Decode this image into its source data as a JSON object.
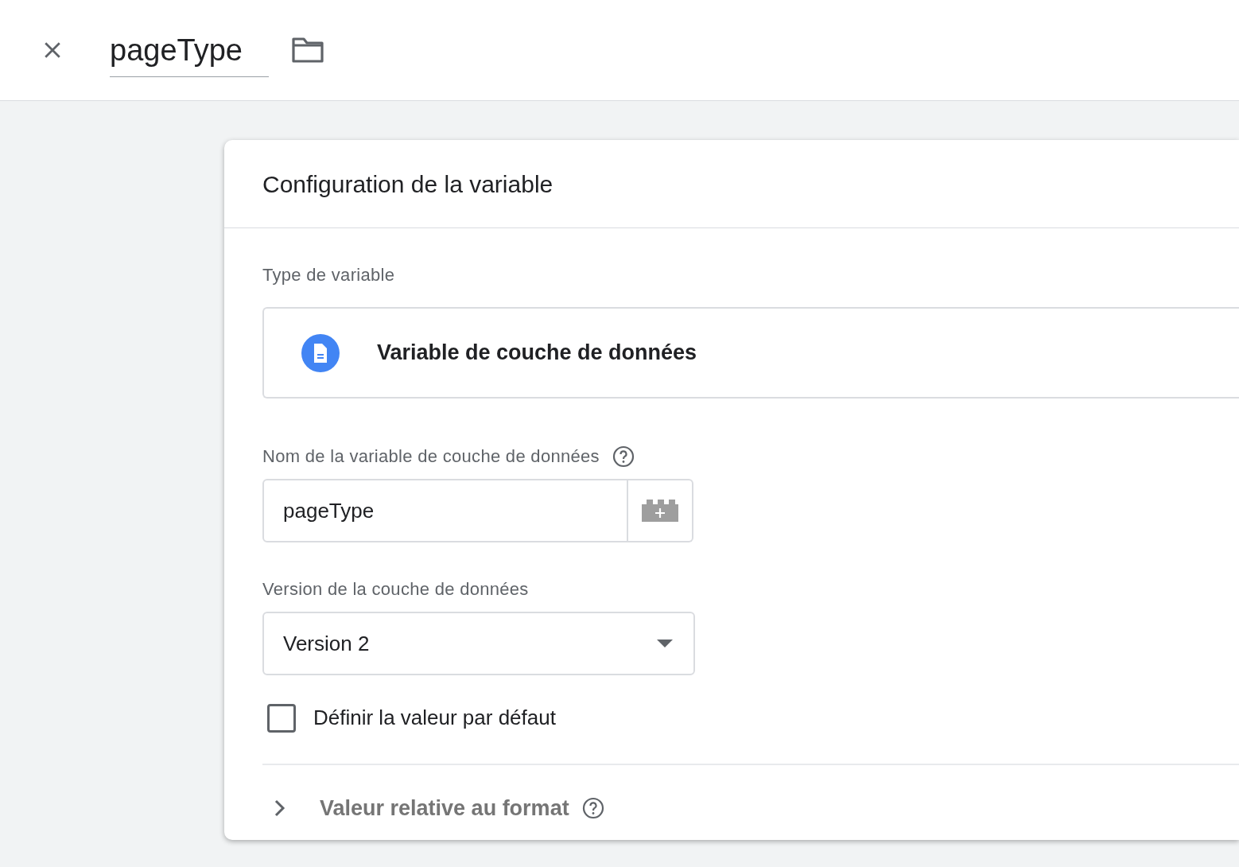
{
  "header": {
    "title": "pageType"
  },
  "card": {
    "title": "Configuration de la variable",
    "type_label": "Type de variable",
    "type_name": "Variable de couche de données",
    "name_label": "Nom de la variable de couche de données",
    "name_value": "pageType",
    "version_label": "Version de la couche de données",
    "version_value": "Version 2",
    "default_checkbox": {
      "label": "Définir la valeur par défaut",
      "checked": false
    },
    "format_section": {
      "label": "Valeur relative au format",
      "expanded": false
    }
  }
}
